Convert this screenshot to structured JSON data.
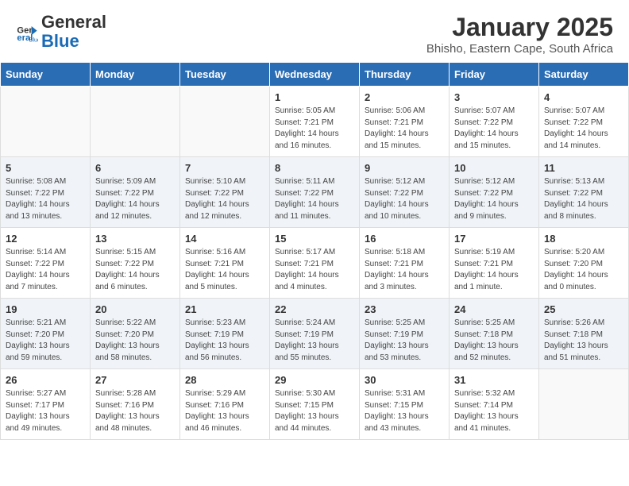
{
  "header": {
    "logo_general": "General",
    "logo_blue": "Blue",
    "main_title": "January 2025",
    "subtitle": "Bhisho, Eastern Cape, South Africa"
  },
  "weekdays": [
    "Sunday",
    "Monday",
    "Tuesday",
    "Wednesday",
    "Thursday",
    "Friday",
    "Saturday"
  ],
  "weeks": [
    {
      "days": [
        {
          "number": "",
          "detail": ""
        },
        {
          "number": "",
          "detail": ""
        },
        {
          "number": "",
          "detail": ""
        },
        {
          "number": "1",
          "detail": "Sunrise: 5:05 AM\nSunset: 7:21 PM\nDaylight: 14 hours\nand 16 minutes."
        },
        {
          "number": "2",
          "detail": "Sunrise: 5:06 AM\nSunset: 7:21 PM\nDaylight: 14 hours\nand 15 minutes."
        },
        {
          "number": "3",
          "detail": "Sunrise: 5:07 AM\nSunset: 7:22 PM\nDaylight: 14 hours\nand 15 minutes."
        },
        {
          "number": "4",
          "detail": "Sunrise: 5:07 AM\nSunset: 7:22 PM\nDaylight: 14 hours\nand 14 minutes."
        }
      ]
    },
    {
      "days": [
        {
          "number": "5",
          "detail": "Sunrise: 5:08 AM\nSunset: 7:22 PM\nDaylight: 14 hours\nand 13 minutes."
        },
        {
          "number": "6",
          "detail": "Sunrise: 5:09 AM\nSunset: 7:22 PM\nDaylight: 14 hours\nand 12 minutes."
        },
        {
          "number": "7",
          "detail": "Sunrise: 5:10 AM\nSunset: 7:22 PM\nDaylight: 14 hours\nand 12 minutes."
        },
        {
          "number": "8",
          "detail": "Sunrise: 5:11 AM\nSunset: 7:22 PM\nDaylight: 14 hours\nand 11 minutes."
        },
        {
          "number": "9",
          "detail": "Sunrise: 5:12 AM\nSunset: 7:22 PM\nDaylight: 14 hours\nand 10 minutes."
        },
        {
          "number": "10",
          "detail": "Sunrise: 5:12 AM\nSunset: 7:22 PM\nDaylight: 14 hours\nand 9 minutes."
        },
        {
          "number": "11",
          "detail": "Sunrise: 5:13 AM\nSunset: 7:22 PM\nDaylight: 14 hours\nand 8 minutes."
        }
      ]
    },
    {
      "days": [
        {
          "number": "12",
          "detail": "Sunrise: 5:14 AM\nSunset: 7:22 PM\nDaylight: 14 hours\nand 7 minutes."
        },
        {
          "number": "13",
          "detail": "Sunrise: 5:15 AM\nSunset: 7:22 PM\nDaylight: 14 hours\nand 6 minutes."
        },
        {
          "number": "14",
          "detail": "Sunrise: 5:16 AM\nSunset: 7:21 PM\nDaylight: 14 hours\nand 5 minutes."
        },
        {
          "number": "15",
          "detail": "Sunrise: 5:17 AM\nSunset: 7:21 PM\nDaylight: 14 hours\nand 4 minutes."
        },
        {
          "number": "16",
          "detail": "Sunrise: 5:18 AM\nSunset: 7:21 PM\nDaylight: 14 hours\nand 3 minutes."
        },
        {
          "number": "17",
          "detail": "Sunrise: 5:19 AM\nSunset: 7:21 PM\nDaylight: 14 hours\nand 1 minute."
        },
        {
          "number": "18",
          "detail": "Sunrise: 5:20 AM\nSunset: 7:20 PM\nDaylight: 14 hours\nand 0 minutes."
        }
      ]
    },
    {
      "days": [
        {
          "number": "19",
          "detail": "Sunrise: 5:21 AM\nSunset: 7:20 PM\nDaylight: 13 hours\nand 59 minutes."
        },
        {
          "number": "20",
          "detail": "Sunrise: 5:22 AM\nSunset: 7:20 PM\nDaylight: 13 hours\nand 58 minutes."
        },
        {
          "number": "21",
          "detail": "Sunrise: 5:23 AM\nSunset: 7:19 PM\nDaylight: 13 hours\nand 56 minutes."
        },
        {
          "number": "22",
          "detail": "Sunrise: 5:24 AM\nSunset: 7:19 PM\nDaylight: 13 hours\nand 55 minutes."
        },
        {
          "number": "23",
          "detail": "Sunrise: 5:25 AM\nSunset: 7:19 PM\nDaylight: 13 hours\nand 53 minutes."
        },
        {
          "number": "24",
          "detail": "Sunrise: 5:25 AM\nSunset: 7:18 PM\nDaylight: 13 hours\nand 52 minutes."
        },
        {
          "number": "25",
          "detail": "Sunrise: 5:26 AM\nSunset: 7:18 PM\nDaylight: 13 hours\nand 51 minutes."
        }
      ]
    },
    {
      "days": [
        {
          "number": "26",
          "detail": "Sunrise: 5:27 AM\nSunset: 7:17 PM\nDaylight: 13 hours\nand 49 minutes."
        },
        {
          "number": "27",
          "detail": "Sunrise: 5:28 AM\nSunset: 7:16 PM\nDaylight: 13 hours\nand 48 minutes."
        },
        {
          "number": "28",
          "detail": "Sunrise: 5:29 AM\nSunset: 7:16 PM\nDaylight: 13 hours\nand 46 minutes."
        },
        {
          "number": "29",
          "detail": "Sunrise: 5:30 AM\nSunset: 7:15 PM\nDaylight: 13 hours\nand 44 minutes."
        },
        {
          "number": "30",
          "detail": "Sunrise: 5:31 AM\nSunset: 7:15 PM\nDaylight: 13 hours\nand 43 minutes."
        },
        {
          "number": "31",
          "detail": "Sunrise: 5:32 AM\nSunset: 7:14 PM\nDaylight: 13 hours\nand 41 minutes."
        },
        {
          "number": "",
          "detail": ""
        }
      ]
    }
  ]
}
